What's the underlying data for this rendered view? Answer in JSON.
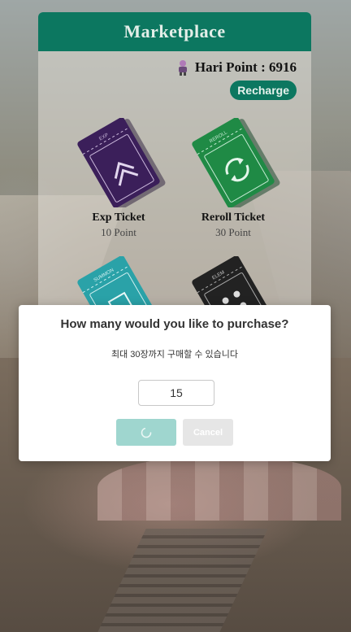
{
  "marketplace": {
    "title": "Marketplace",
    "points_label": "Hari Point : 6916",
    "recharge_label": "Recharge",
    "items": [
      {
        "name": "Exp Ticket",
        "price": "10 Point",
        "color": "#3b1f5a",
        "icon": "double-chevron-up-icon"
      },
      {
        "name": "Reroll Ticket",
        "price": "30 Point",
        "color": "#1f8a45",
        "icon": "reroll-arrows-icon"
      },
      {
        "name": "",
        "price": "",
        "color": "#2aa2a8",
        "icon": "summon-ticket-icon"
      },
      {
        "name": "",
        "price": "",
        "color": "#222222",
        "icon": "element-ticket-icon"
      }
    ]
  },
  "dialog": {
    "title": "How many would you like to purchase?",
    "subtitle": "최대 30장까지 구매할 수 있습니다",
    "quantity_value": "15",
    "confirm_state": "loading",
    "cancel_label": "Cancel"
  },
  "colors": {
    "accent": "#0c7760",
    "confirm_button": "#9fd6cf",
    "cancel_button": "#e6e6e6"
  }
}
